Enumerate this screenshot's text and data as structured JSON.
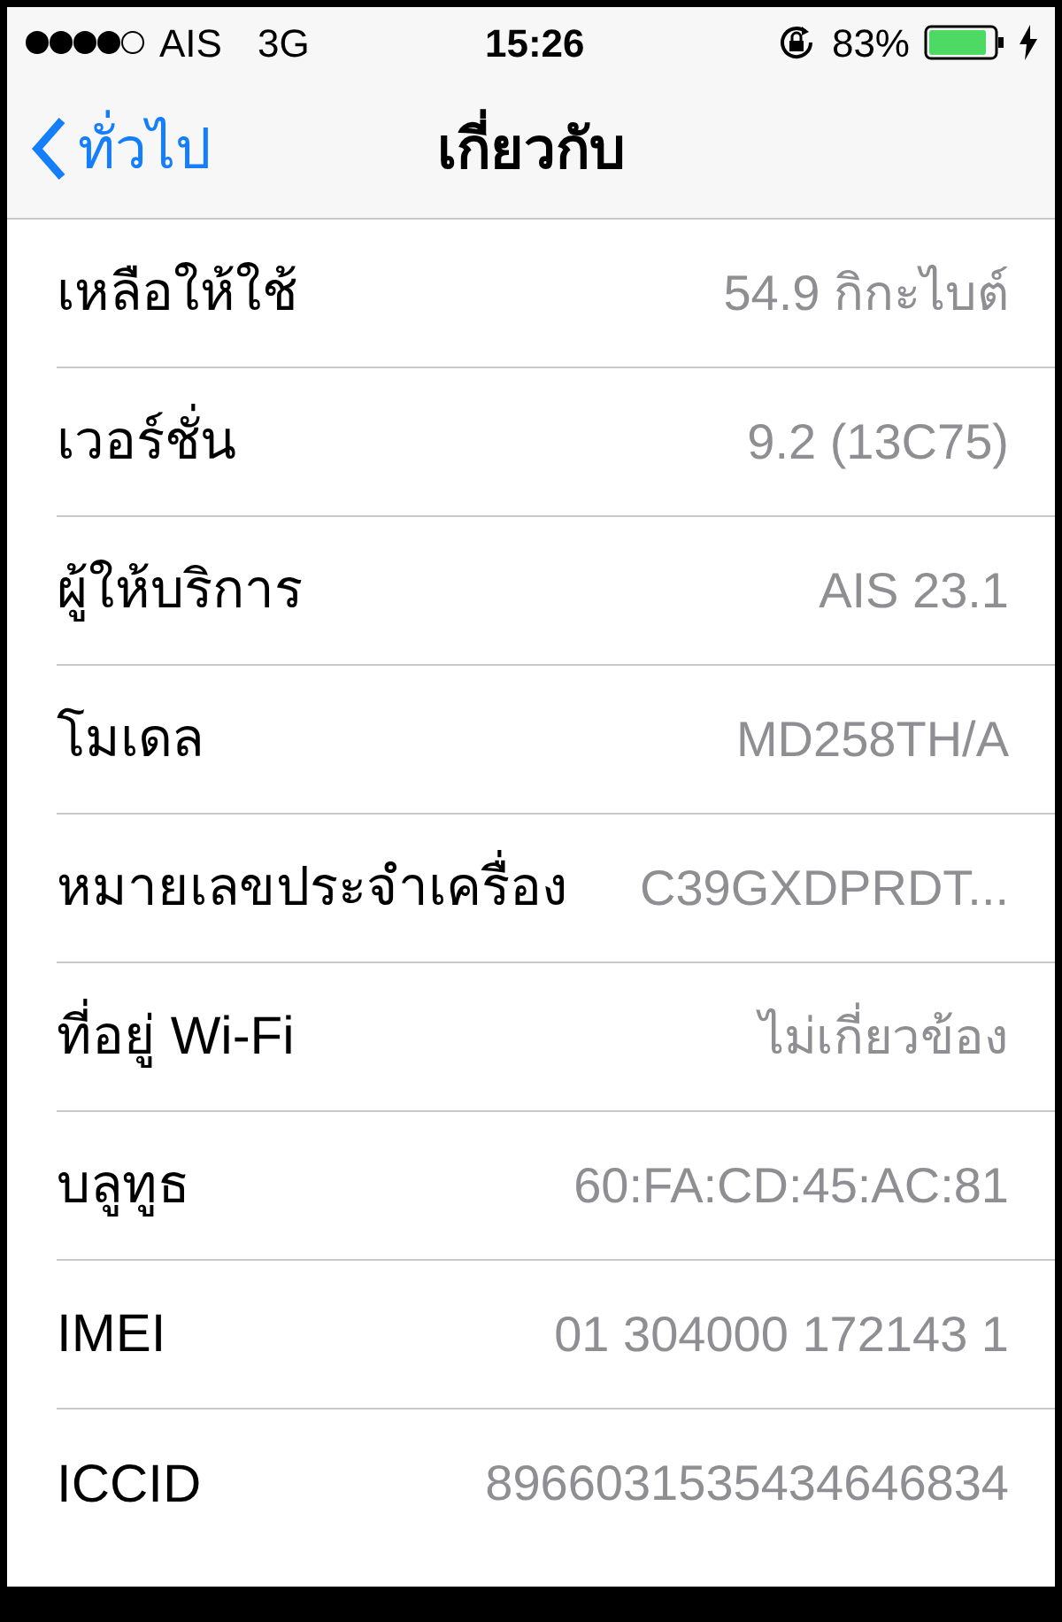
{
  "status_bar": {
    "carrier": "AIS",
    "network": "3G",
    "time": "15:26",
    "battery_percent": "83%"
  },
  "nav_bar": {
    "back_label": "ทั่วไป",
    "title": "เกี่ยวกับ"
  },
  "rows": [
    {
      "label": "เหลือให้ใช้",
      "value": "54.9 กิกะไบต์"
    },
    {
      "label": "เวอร์ชั่น",
      "value": "9.2 (13C75)"
    },
    {
      "label": "ผู้ให้บริการ",
      "value": "AIS 23.1"
    },
    {
      "label": "โมเดล",
      "value": "MD258TH/A"
    },
    {
      "label": "หมายเลขประจำเครื่อง",
      "value": "C39GXDPRDT..."
    },
    {
      "label": "ที่อยู่ Wi-Fi",
      "value": "ไม่เกี่ยวข้อง"
    },
    {
      "label": "บลูทูธ",
      "value": "60:FA:CD:45:AC:81"
    },
    {
      "label": "IMEI",
      "value": "01 304000 172143 1"
    },
    {
      "label": "ICCID",
      "value": "8966031535434646834"
    }
  ]
}
